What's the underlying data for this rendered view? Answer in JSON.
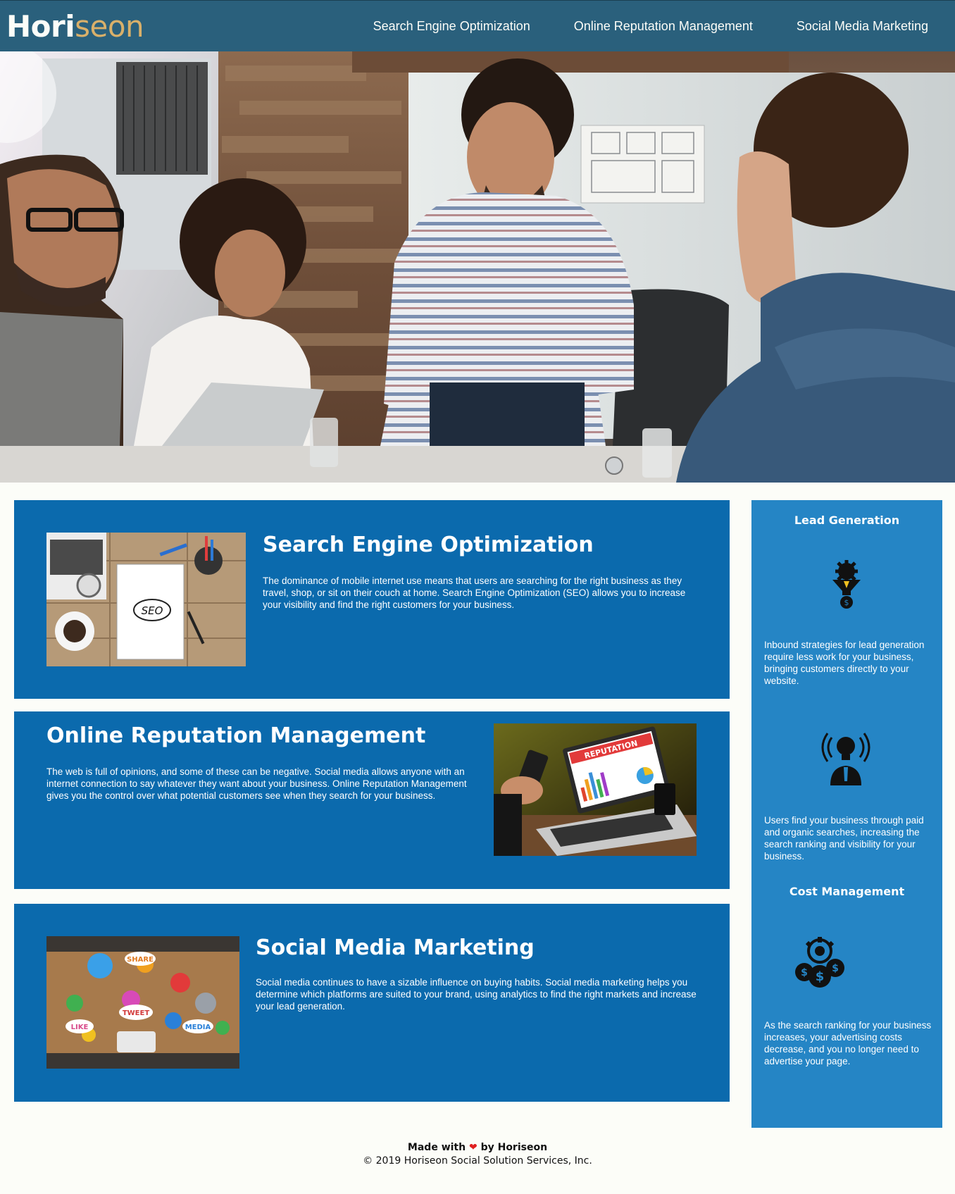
{
  "header": {
    "logo_main": "Hori",
    "logo_accent": "seon",
    "nav": [
      {
        "label": "Search Engine Optimization"
      },
      {
        "label": "Online Reputation Management"
      },
      {
        "label": "Social Media Marketing"
      }
    ]
  },
  "sections": {
    "seo": {
      "title": "Search Engine Optimization",
      "text": "The dominance of mobile internet use means that users are searching for the right business as they travel, shop, or sit on their couch at home. Search Engine Optimization (SEO) allows you to increase your visibility and find the right customers for your business.",
      "image_text": "SEO"
    },
    "orm": {
      "title": "Online Reputation Management",
      "text": "The web is full of opinions, and some of these can be negative. Social media allows anyone with an internet connection to say whatever they want about your business. Online Reputation Management gives you the control over what potential customers see when they search for your business.",
      "image_text": "REPUTATION"
    },
    "smm": {
      "title": "Social Media Marketing",
      "text": "Social media continues to have a sizable influence on buying habits. Social media marketing helps you determine which platforms are suited to your brand, using analytics to find the right markets and increase your lead generation.",
      "image_words": [
        "SHARE",
        "TWEET",
        "LIKE",
        "MEDIA"
      ]
    }
  },
  "sidebar": {
    "lead": {
      "title": "Lead Generation",
      "text": "Inbound strategies for lead generation require less work for your business, bringing customers directly to your website."
    },
    "brand": {
      "text": "Users find your business through paid and organic searches, increasing the search ranking and visibility for your business."
    },
    "cost": {
      "title": "Cost Management",
      "text": "As the search ranking for your business increases, your advertising costs decrease, and you no longer need to advertise your page."
    }
  },
  "footer": {
    "made_prefix": "Made with",
    "heart": "❤",
    "made_suffix": "by Horiseon",
    "copyright": "© 2019 Horiseon Social Solution Services, Inc."
  },
  "colors": {
    "header": "#2a607c",
    "logo_accent": "#d9b06a",
    "card": "#0b6aad",
    "sidebar": "#2585c5"
  }
}
